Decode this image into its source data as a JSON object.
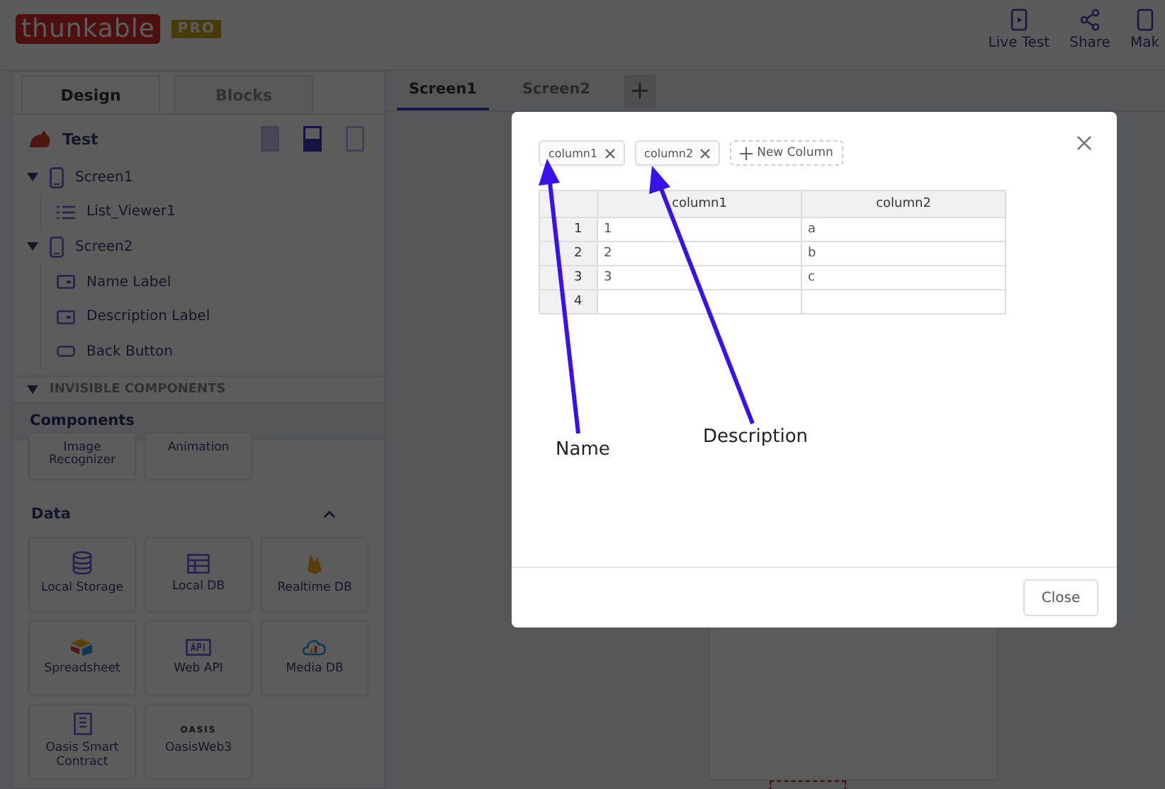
{
  "header": {
    "logo": "thunkable",
    "badge": "PRO",
    "actions": [
      {
        "label": "Live Test",
        "kind": "live"
      },
      {
        "label": "Share",
        "kind": "share"
      },
      {
        "label": "Mak",
        "kind": "make"
      }
    ]
  },
  "mode_tabs": [
    {
      "label": "Design",
      "selected": true
    },
    {
      "label": "Blocks",
      "selected": false
    }
  ],
  "screen_tabs": [
    {
      "label": "Screen1",
      "selected": true
    },
    {
      "label": "Screen2",
      "selected": false
    }
  ],
  "tree": {
    "project": "Test",
    "views": [
      {
        "selected": false
      },
      {
        "selected": true
      },
      {
        "selected": false
      }
    ],
    "items": [
      {
        "label": "Screen1",
        "kind": "screen",
        "expanded": true,
        "children": [
          {
            "label": "List_Viewer1",
            "kind": "list"
          }
        ]
      },
      {
        "label": "Screen2",
        "kind": "screen",
        "expanded": true,
        "children": [
          {
            "label": "Name Label",
            "kind": "label"
          },
          {
            "label": "Description Label",
            "kind": "label"
          },
          {
            "label": "Back Button",
            "kind": "button"
          }
        ]
      }
    ]
  },
  "invisible": {
    "label": "INVISIBLE COMPONENTS",
    "expanded": true
  },
  "components": {
    "title": "Components",
    "partial_tiles": [
      "Image Recognizer",
      "Animation"
    ],
    "section": {
      "label": "Data",
      "expanded": true
    },
    "tiles": [
      {
        "label": "Local Storage",
        "kind": "storage"
      },
      {
        "label": "Local DB",
        "kind": "table"
      },
      {
        "label": "Realtime DB",
        "kind": "fire"
      },
      {
        "label": "Spreadsheet",
        "kind": "sheet"
      },
      {
        "label": "Web API",
        "kind": "api"
      },
      {
        "label": "Media DB",
        "kind": "cloud"
      },
      {
        "label": "Oasis Smart Contract",
        "kind": "doc"
      },
      {
        "label": "OasisWeb3",
        "kind": "oasis",
        "mark": "OASIS"
      }
    ]
  },
  "modal": {
    "chips": [
      {
        "label": "column1"
      },
      {
        "label": "column2"
      }
    ],
    "add_label": "New Column",
    "columns": [
      "column1",
      "column2"
    ],
    "rows": [
      {
        "index": "1",
        "cells": [
          "1",
          "a"
        ]
      },
      {
        "index": "2",
        "cells": [
          "2",
          "b"
        ]
      },
      {
        "index": "3",
        "cells": [
          "3",
          "c"
        ]
      },
      {
        "index": "4",
        "cells": []
      }
    ],
    "annotations": [
      {
        "label": "Name"
      },
      {
        "label": "Description"
      }
    ],
    "close": "Close"
  }
}
